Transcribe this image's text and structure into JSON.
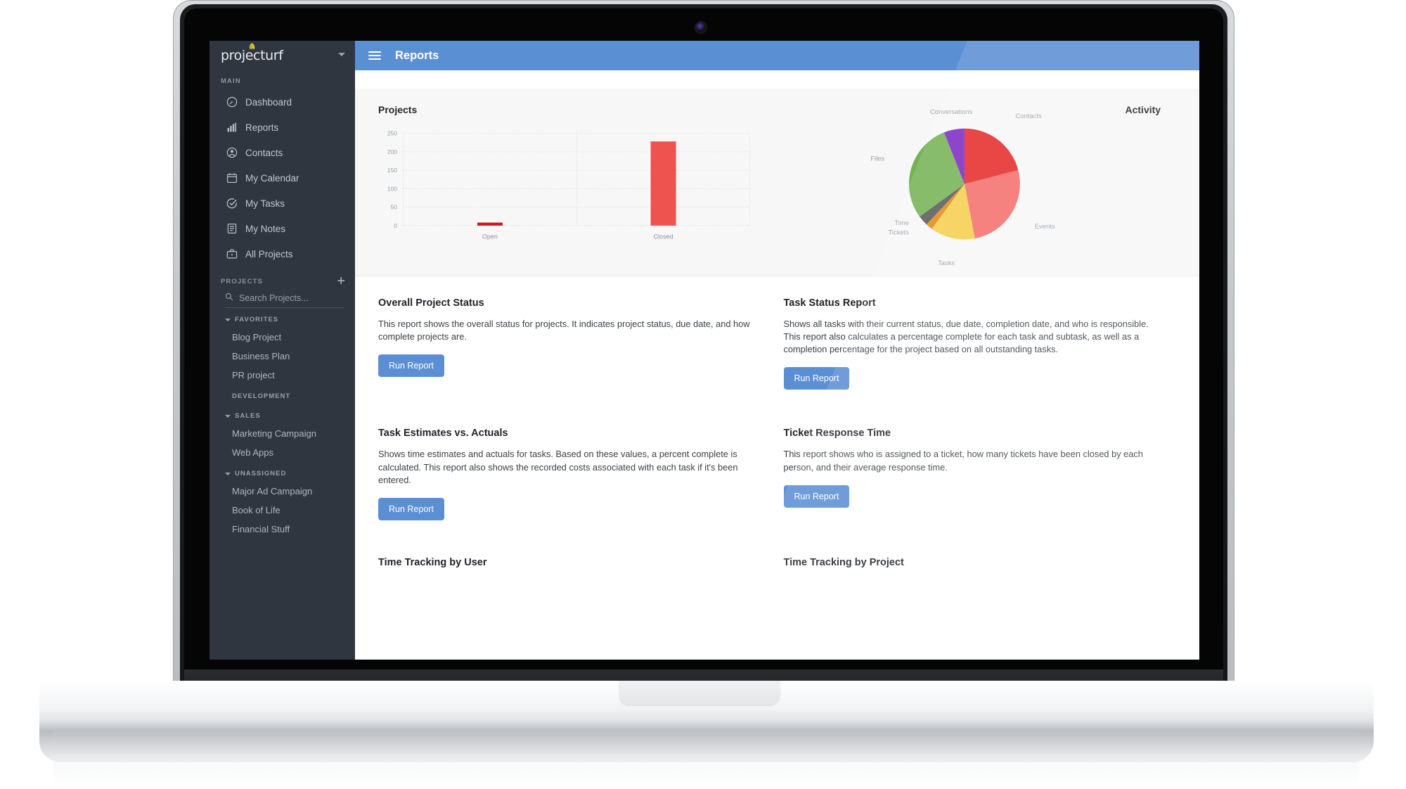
{
  "brand": {
    "name": "projecturf",
    "caret_icon": "chevron-down-icon"
  },
  "sidebar": {
    "main_label": "MAIN",
    "nav": [
      {
        "label": "Dashboard",
        "icon": "dashboard-gauge-icon"
      },
      {
        "label": "Reports",
        "icon": "bar-chart-icon"
      },
      {
        "label": "Contacts",
        "icon": "person-circle-icon"
      },
      {
        "label": "My Calendar",
        "icon": "calendar-icon"
      },
      {
        "label": "My Tasks",
        "icon": "check-circle-icon"
      },
      {
        "label": "My Notes",
        "icon": "notes-icon"
      },
      {
        "label": "All Projects",
        "icon": "briefcase-icon"
      }
    ],
    "projects_label": "PROJECTS",
    "add_project_icon": "plus-icon",
    "search": {
      "placeholder": "Search Projects...",
      "value": "",
      "icon": "search-icon"
    },
    "groups": [
      {
        "label": "FAVORITES",
        "collapsible": true,
        "items": [
          "Blog Project",
          "Business Plan",
          "PR project"
        ]
      },
      {
        "label": "DEVELOPMENT",
        "collapsible": false,
        "items": []
      },
      {
        "label": "SALES",
        "collapsible": true,
        "items": [
          "Marketing Campaign",
          "Web Apps"
        ]
      },
      {
        "label": "UNASSIGNED",
        "collapsible": true,
        "items": [
          "Major Ad Campaign",
          "Book of Life",
          "Financial Stuff"
        ]
      }
    ]
  },
  "topbar": {
    "menu_icon": "hamburger-menu-icon",
    "title": "Reports",
    "accent": "#5b8fd4"
  },
  "chart_data": [
    {
      "type": "bar",
      "title": "Projects",
      "categories": [
        "Open",
        "Closed"
      ],
      "values": [
        3,
        228
      ],
      "xlabel": "",
      "ylabel": "",
      "ylim": [
        0,
        250
      ],
      "yticks": [
        0,
        50,
        100,
        150,
        200,
        250
      ],
      "grid": true,
      "legend": "none",
      "colors": [
        "#d4141e",
        "#ef5350"
      ]
    },
    {
      "type": "pie",
      "title": "Activity",
      "labels": [
        "Contacts",
        "Events",
        "Tasks",
        "Tickets",
        "Time",
        "Files",
        "Conversations"
      ],
      "values": [
        21,
        26,
        13,
        2,
        3,
        29,
        6
      ],
      "colors": [
        "#e62b2b",
        "#f4706c",
        "#f6cf4f",
        "#e08a14",
        "#5a5a5a",
        "#74b354",
        "#7d2bc4"
      ],
      "legend": "labels-around-pie"
    }
  ],
  "reports": [
    {
      "title": "Overall Project Status",
      "description": "This report shows the overall status for projects. It indicates project status, due date, and how complete projects are.",
      "button": "Run Report"
    },
    {
      "title": "Task Status Report",
      "description": "Shows all tasks with their current status, due date, completion date, and who is responsible. This report also calculates a percentage complete for each task and subtask, as well as a completion percentage for the project based on all outstanding tasks.",
      "button": "Run Report"
    },
    {
      "title": "Task Estimates vs. Actuals",
      "description": "Shows time estimates and actuals for tasks. Based on these values, a percent complete is calculated. This report also shows the recorded costs associated with each task if it's been entered.",
      "button": "Run Report"
    },
    {
      "title": "Ticket Response Time",
      "description": "This report shows who is assigned to a ticket, how many tickets have been closed by each person, and their average response time.",
      "button": "Run Report"
    },
    {
      "title": "Time Tracking by User",
      "description": "",
      "button": ""
    },
    {
      "title": "Time Tracking by Project",
      "description": "",
      "button": ""
    }
  ]
}
